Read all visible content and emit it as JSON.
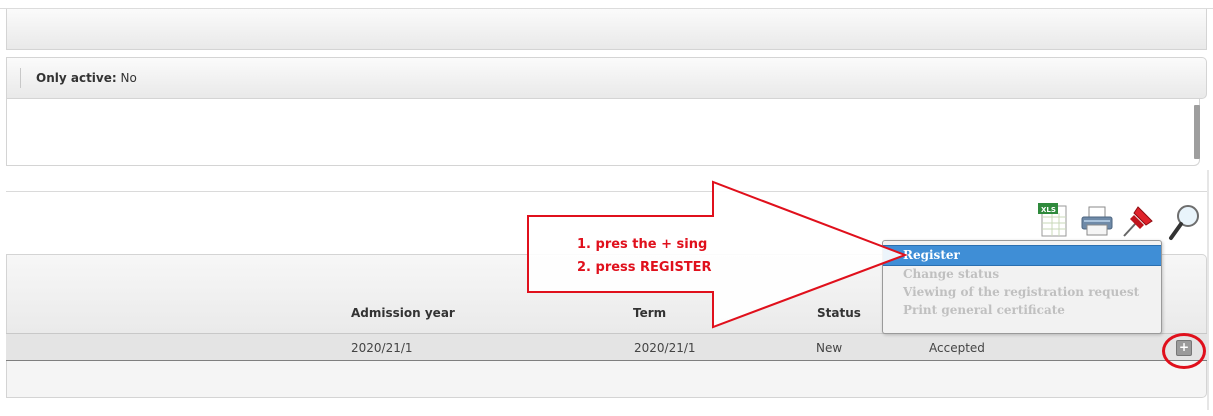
{
  "filter": {
    "label": "Only active:",
    "value": "No"
  },
  "table": {
    "columns": [
      "Admission year",
      "Term",
      "Status"
    ],
    "row": {
      "admission_year": "2020/21/1",
      "term": "2020/21/1",
      "status": "New",
      "result": "Accepted"
    },
    "row_action": "+"
  },
  "toolbar": {
    "icons": [
      "xls-export-icon",
      "print-icon",
      "pin-icon",
      "search-icon"
    ],
    "xls_badge": "XLS"
  },
  "context_menu": {
    "items": [
      "Register",
      "Change status",
      "Viewing of the registration request",
      "Print general certificate"
    ],
    "active_index": 0
  },
  "annotation": {
    "step1": "1. pres the + sing",
    "step2": "2. press REGISTER",
    "color": "#e0101c"
  }
}
